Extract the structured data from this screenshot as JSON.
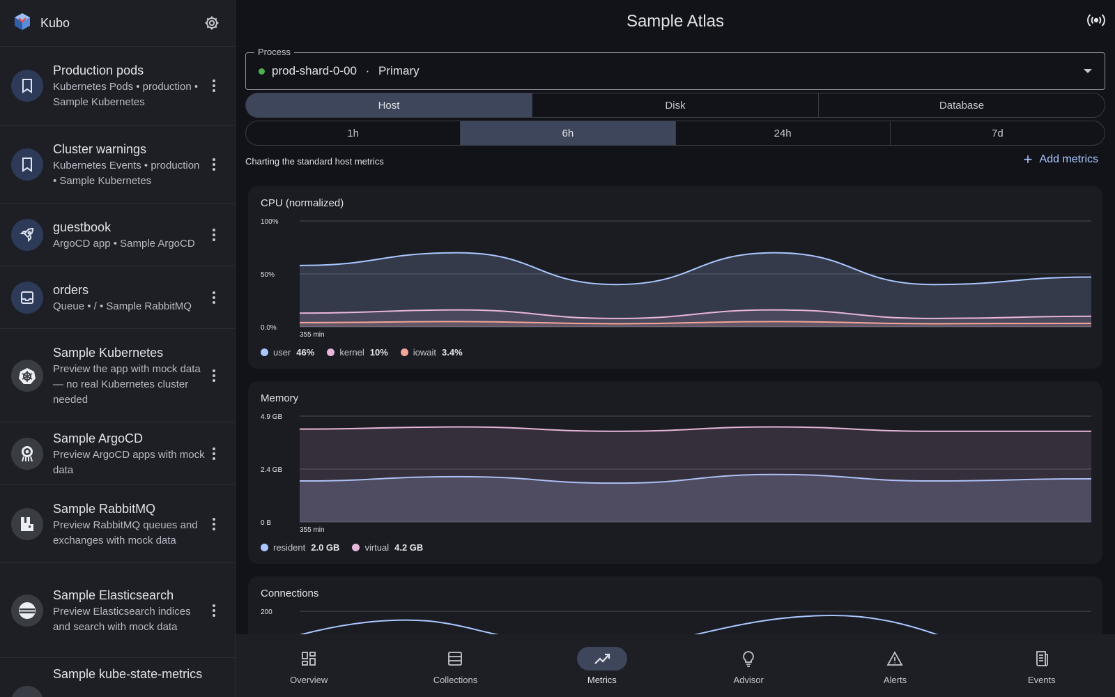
{
  "app": {
    "name": "Kubo"
  },
  "sidebar": {
    "items": [
      {
        "title": "Production pods",
        "subtitle": "Kubernetes Pods • production • Sample Kubernetes",
        "icon": "bookmark-icon"
      },
      {
        "title": "Cluster warnings",
        "subtitle": "Kubernetes Events • production • Sample Kubernetes",
        "icon": "bookmark-icon"
      },
      {
        "title": "guestbook",
        "subtitle": "ArgoCD app • Sample ArgoCD",
        "icon": "rocket-icon"
      },
      {
        "title": "orders",
        "subtitle": "Queue • / • Sample RabbitMQ",
        "icon": "inbox-icon"
      },
      {
        "title": "Sample Kubernetes",
        "subtitle": "Preview the app with mock data — no real Kubernetes cluster needed",
        "icon": "kubernetes-icon"
      },
      {
        "title": "Sample ArgoCD",
        "subtitle": "Preview ArgoCD apps with mock data",
        "icon": "argocd-icon"
      },
      {
        "title": "Sample RabbitMQ",
        "subtitle": "Preview RabbitMQ queues and exchanges with mock data",
        "icon": "rabbitmq-icon"
      },
      {
        "title": "Sample Elasticsearch",
        "subtitle": "Preview Elasticsearch indices and search with mock data",
        "icon": "elasticsearch-icon"
      },
      {
        "title": "Sample kube-state-metrics",
        "subtitle": "",
        "icon": "metrics-icon"
      }
    ]
  },
  "header": {
    "title": "Sample Atlas"
  },
  "process": {
    "legend": "Process",
    "name": "prod-shard-0-00",
    "separator": "·",
    "role": "Primary",
    "status_color": "#4caf50"
  },
  "tabs": [
    {
      "label": "Host",
      "active": true
    },
    {
      "label": "Disk",
      "active": false
    },
    {
      "label": "Database",
      "active": false
    }
  ],
  "ranges": [
    {
      "label": "1h",
      "active": false
    },
    {
      "label": "6h",
      "active": true
    },
    {
      "label": "24h",
      "active": false
    },
    {
      "label": "7d",
      "active": false
    }
  ],
  "caption": "Charting the standard host metrics",
  "add_metrics": {
    "plus": "+",
    "label": "Add metrics"
  },
  "charts": {
    "cpu": {
      "title": "CPU (normalized)",
      "y_ticks": [
        "100%",
        "50%",
        "0.0%"
      ],
      "x_label": "355 min",
      "legend": [
        {
          "name": "user",
          "value": "46%",
          "color": "#aac7ff"
        },
        {
          "name": "kernel",
          "value": "10%",
          "color": "#e8b6da"
        },
        {
          "name": "iowait",
          "value": "3.4%",
          "color": "#f5a59a"
        }
      ]
    },
    "memory": {
      "title": "Memory",
      "y_ticks": [
        "4.9 GB",
        "2.4 GB",
        "0 B"
      ],
      "x_label": "355 min",
      "legend": [
        {
          "name": "resident",
          "value": "2.0 GB",
          "color": "#aac7ff"
        },
        {
          "name": "virtual",
          "value": "4.2 GB",
          "color": "#e8b6da"
        }
      ]
    },
    "connections": {
      "title": "Connections",
      "y_ticks": [
        "200"
      ]
    }
  },
  "chart_data": [
    {
      "type": "area",
      "title": "CPU (normalized)",
      "ylim": [
        0,
        100
      ],
      "series": [
        {
          "name": "user",
          "values": [
            58,
            70,
            40,
            70,
            40,
            47
          ]
        },
        {
          "name": "kernel",
          "values": [
            13,
            16,
            8,
            16,
            8,
            10
          ]
        },
        {
          "name": "iowait",
          "values": [
            4,
            5,
            3,
            5,
            3,
            3.4
          ]
        }
      ]
    },
    {
      "type": "area",
      "title": "Memory",
      "ylim": [
        0,
        4.9
      ],
      "series": [
        {
          "name": "resident",
          "values": [
            1.9,
            2.1,
            1.8,
            2.2,
            1.9,
            2.0
          ]
        },
        {
          "name": "virtual",
          "values": [
            4.3,
            4.4,
            4.2,
            4.4,
            4.2,
            4.2
          ]
        }
      ]
    }
  ],
  "nav": [
    {
      "label": "Overview",
      "icon": "dashboard-icon",
      "active": false
    },
    {
      "label": "Collections",
      "icon": "collections-icon",
      "active": false
    },
    {
      "label": "Metrics",
      "icon": "trend-icon",
      "active": true
    },
    {
      "label": "Advisor",
      "icon": "lightbulb-icon",
      "active": false
    },
    {
      "label": "Alerts",
      "icon": "warning-icon",
      "active": false
    },
    {
      "label": "Events",
      "icon": "receipt-icon",
      "active": false
    }
  ]
}
